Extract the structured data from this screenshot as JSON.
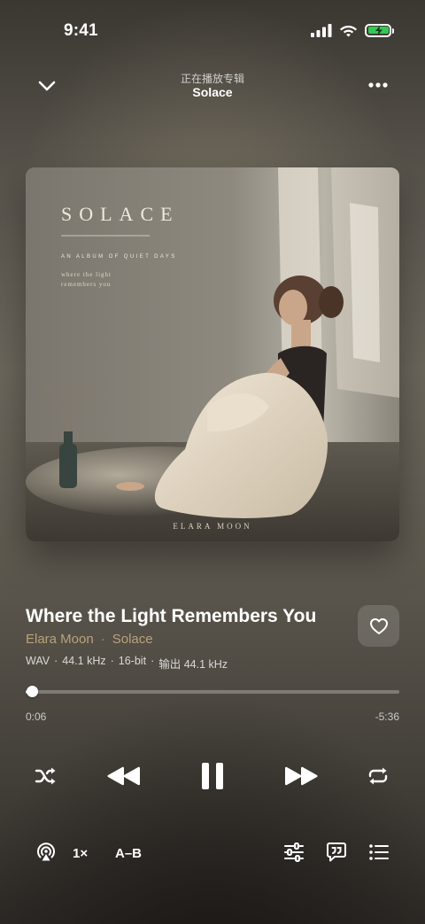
{
  "status_bar": {
    "time": "9:41"
  },
  "header": {
    "subtitle": "正在播放专辑",
    "title": "Solace"
  },
  "artwork": {
    "title": "SOLACE",
    "subtitle": "AN ALBUM OF QUIET DAYS",
    "tagline_1": "where the light",
    "tagline_2": "remembers you",
    "artist": "ELARA MOON"
  },
  "track": {
    "title": "Where the Light Remembers You",
    "artist": "Elara Moon",
    "separator": "·",
    "album": "Solace",
    "format": "WAV",
    "sample_rate": "44.1 kHz",
    "bit_depth": "16-bit",
    "output": "输出 44.1 kHz"
  },
  "progress": {
    "elapsed": "0:06",
    "remaining": "-5:36",
    "fraction": 0.017
  },
  "toolbar": {
    "speed_label": "1×",
    "ab_label": "A–B"
  },
  "icons": {
    "collapse": "chevron-down-icon",
    "more": "more-horizontal-icon",
    "like": "heart-icon",
    "shuffle": "shuffle-icon",
    "previous": "previous-track-icon",
    "pause": "pause-icon",
    "next": "next-track-icon",
    "repeat": "repeat-icon",
    "airplay": "airplay-icon",
    "equalizer": "equalizer-icon",
    "lyrics": "lyrics-icon",
    "queue": "queue-icon"
  },
  "colors": {
    "accent": "#b8a27a",
    "battery": "#34c759"
  }
}
